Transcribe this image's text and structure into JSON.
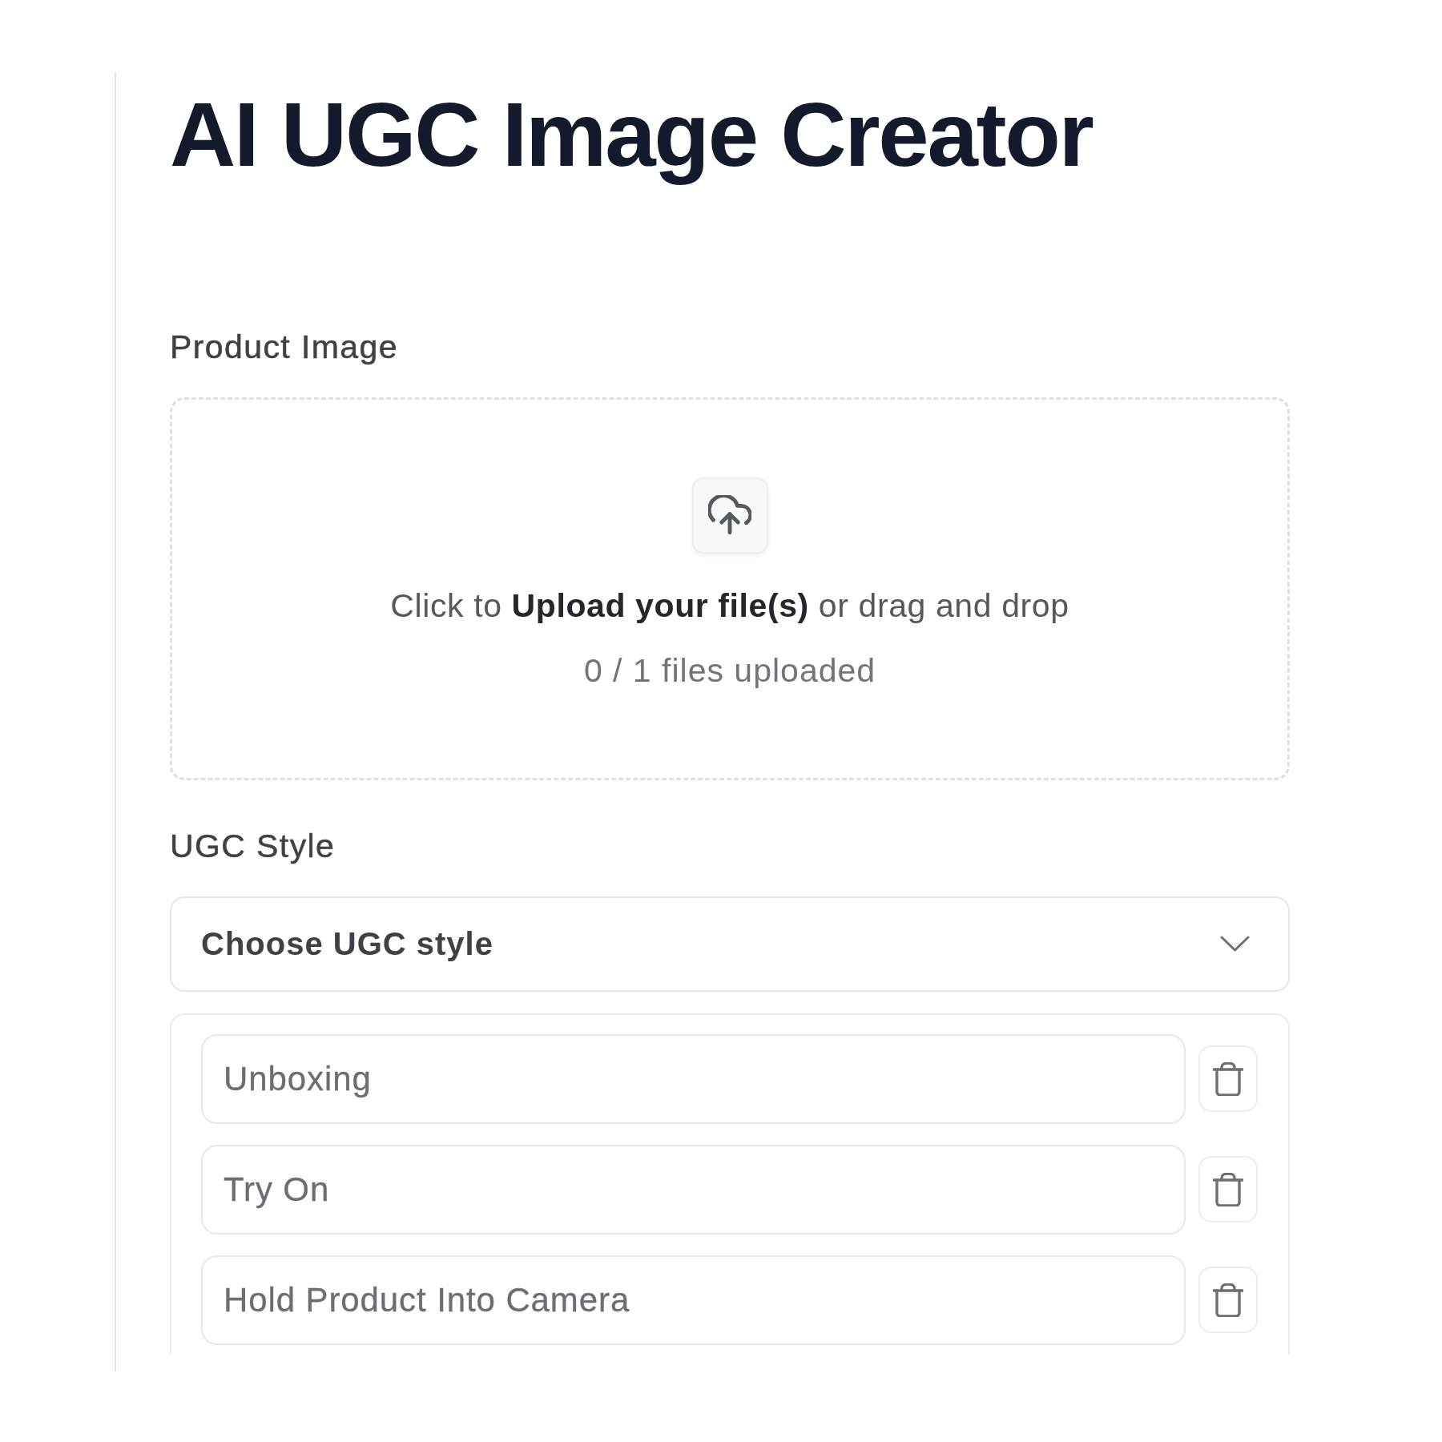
{
  "title": "AI UGC Image Creator",
  "product_image": {
    "label": "Product Image",
    "upload": {
      "prompt": "Click to **Upload your file(s)** or drag and drop",
      "count": "0 / 1 files uploaded"
    }
  },
  "ugc_style": {
    "label": "UGC Style",
    "select": {
      "placeholder": "Choose UGC style"
    },
    "styles": [
      {
        "value": "Unboxing"
      },
      {
        "value": "Try On"
      },
      {
        "value": "Hold Product Into Camera"
      }
    ]
  }
}
